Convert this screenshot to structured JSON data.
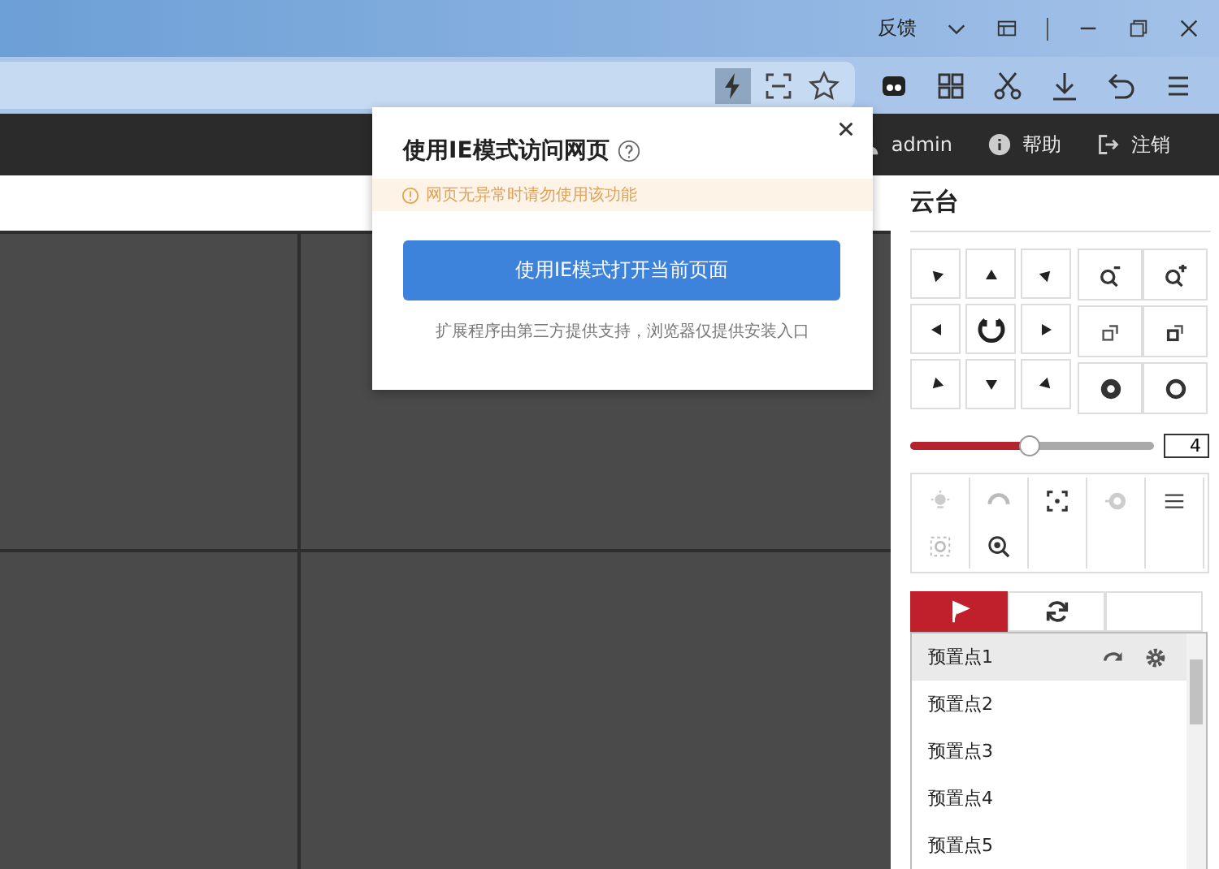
{
  "browser": {
    "feedback": "反馈"
  },
  "popup": {
    "title": "使用IE模式访问网页",
    "hint": "网页无异常时请勿使用该功能",
    "button": "使用IE模式打开当前页面",
    "note": "扩展程序由第三方提供支持，浏览器仅提供安装入口"
  },
  "header": {
    "user": "admin",
    "help": "帮助",
    "logout": "注销"
  },
  "ptz": {
    "title": "云台",
    "speed": {
      "level": 0.49,
      "value": "4"
    },
    "tabs": [
      {
        "kind": "preset",
        "selected": true
      },
      {
        "kind": "patrol",
        "selected": false
      },
      {
        "kind": "empty",
        "selected": false
      }
    ],
    "presets": [
      {
        "name": "预置点1",
        "selected": true
      },
      {
        "name": "预置点2",
        "selected": false
      },
      {
        "name": "预置点3",
        "selected": false
      },
      {
        "name": "预置点4",
        "selected": false
      },
      {
        "name": "预置点5",
        "selected": false
      }
    ]
  }
}
